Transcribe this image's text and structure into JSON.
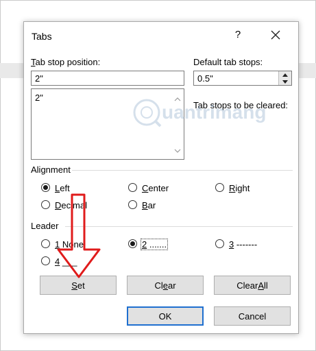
{
  "dialog": {
    "title": "Tabs",
    "help": "?"
  },
  "tab_stop": {
    "label_first": "T",
    "label_rest": "ab stop position:",
    "value": "2\"",
    "list_items": [
      "2\""
    ]
  },
  "default_tab_stops": {
    "label_first": "Default tab stops:",
    "value": "0.5\""
  },
  "to_be_cleared": {
    "label": "Tab stops to be cleared:"
  },
  "alignment": {
    "group_label": "Alignment",
    "options": {
      "left": {
        "first": "L",
        "rest": "eft",
        "selected": true
      },
      "center": {
        "first": "C",
        "rest": "enter",
        "selected": false
      },
      "right": {
        "first": "R",
        "rest": "ight",
        "selected": false
      },
      "decimal": {
        "first": "D",
        "rest": "ecimal",
        "selected": false
      },
      "bar": {
        "first": "B",
        "rest": "ar",
        "selected": false
      }
    }
  },
  "leader": {
    "group_label": "Leader",
    "options": {
      "one": {
        "first": "1",
        "rest": " None",
        "selected": false
      },
      "two": {
        "first": "2",
        "rest": " .......",
        "selected": true
      },
      "three": {
        "first": "3",
        "rest": " -------",
        "selected": false
      },
      "four": {
        "first": "4",
        "rest": " ___",
        "selected": false
      }
    }
  },
  "buttons": {
    "set": {
      "first": "S",
      "rest": "et"
    },
    "clear": {
      "pre": "Cl",
      "first": "e",
      "rest": "ar"
    },
    "clear_all": {
      "pre": "Clear ",
      "first": "A",
      "rest": "ll"
    },
    "ok": "OK",
    "cancel": "Cancel"
  },
  "watermark": {
    "text": "uantrimang"
  },
  "colors": {
    "accent": "#1e6fcf",
    "annotation_arrow": "#e01b1b"
  }
}
